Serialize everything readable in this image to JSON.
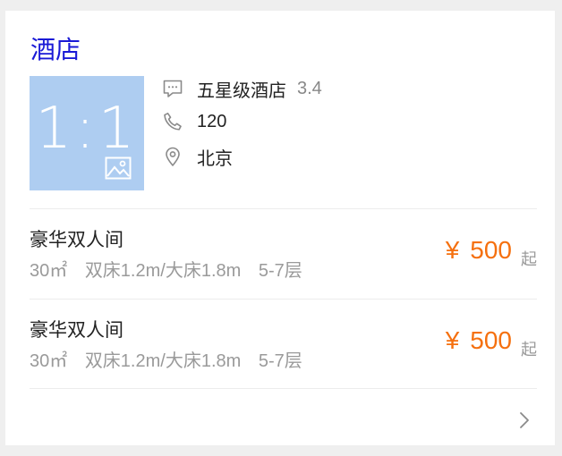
{
  "card": {
    "title": "酒店",
    "image_placeholder": "1:1",
    "info": {
      "type": "五星级酒店",
      "rating": "3.4",
      "phone": "120",
      "location": "北京"
    },
    "rooms": [
      {
        "name": "豪华双人间",
        "area": "30㎡",
        "bed": "双床1.2m/大床1.8m",
        "floor": "5-7层",
        "currency": "¥",
        "price": "500",
        "suffix": "起"
      },
      {
        "name": "豪华双人间",
        "area": "30㎡",
        "bed": "双床1.2m/大床1.8m",
        "floor": "5-7层",
        "currency": "¥",
        "price": "500",
        "suffix": "起"
      }
    ]
  },
  "colors": {
    "title": "#1a1ad6",
    "price": "#f5700f",
    "thumb": "#aecdf1"
  },
  "icons": [
    "message-icon",
    "phone-icon",
    "location-pin-icon",
    "image-icon",
    "chevron-right-icon"
  ]
}
